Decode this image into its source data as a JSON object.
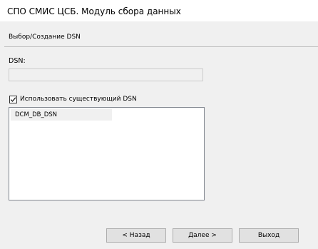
{
  "window": {
    "title": "СПО СМИС ЦСБ. Модуль сбора данных"
  },
  "page": {
    "header": "Выбор/Создание DSN"
  },
  "dsn": {
    "label": "DSN:",
    "value": "",
    "enabled": false
  },
  "use_existing": {
    "label": "Использовать существующий DSN",
    "checked": true
  },
  "dsn_list": {
    "items": [
      "DCM_DB_DSN"
    ],
    "selected_index": 0
  },
  "buttons": {
    "back_label": "< Назад",
    "next_label": "Далее >",
    "exit_label": "Выход"
  },
  "icons": {
    "checkbox_check": "check-icon"
  }
}
